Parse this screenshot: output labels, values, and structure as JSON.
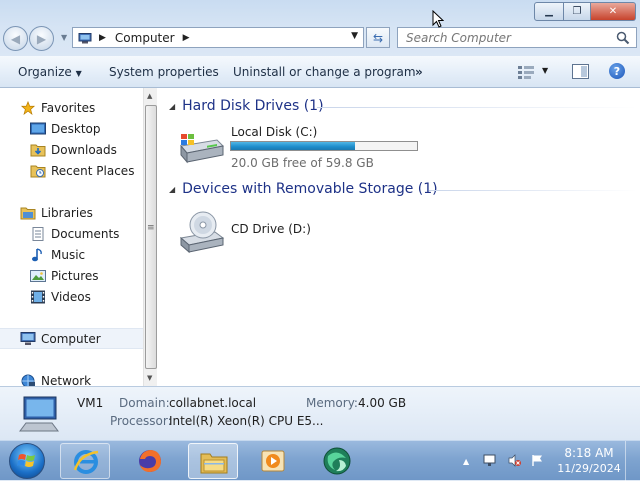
{
  "window": {
    "address": {
      "location": "Computer"
    },
    "search": {
      "placeholder": "Search Computer"
    }
  },
  "toolbar": {
    "organize_label": "Organize",
    "system_properties_label": "System properties",
    "uninstall_label": "Uninstall or change a program",
    "more_label": "»"
  },
  "navigation": {
    "favorites": {
      "label": "Favorites",
      "items": [
        {
          "label": "Desktop"
        },
        {
          "label": "Downloads"
        },
        {
          "label": "Recent Places"
        }
      ]
    },
    "libraries": {
      "label": "Libraries",
      "items": [
        {
          "label": "Documents"
        },
        {
          "label": "Music"
        },
        {
          "label": "Pictures"
        },
        {
          "label": "Videos"
        }
      ]
    },
    "computer": {
      "label": "Computer"
    },
    "network": {
      "label": "Network"
    }
  },
  "content": {
    "groups": [
      {
        "header": "Hard Disk Drives (1)",
        "items": [
          {
            "name": "Local Disk (C:)",
            "free_text": "20.0 GB free of 59.8 GB",
            "used_fraction": 0.666,
            "icon": "hard-drive-icon"
          }
        ]
      },
      {
        "header": "Devices with Removable Storage (1)",
        "items": [
          {
            "name": "CD Drive (D:)",
            "icon": "cd-drive-icon"
          }
        ]
      }
    ]
  },
  "details": {
    "computer_name": "VM1",
    "domain_label": "Domain:",
    "domain_value": "collabnet.local",
    "memory_label": "Memory:",
    "memory_value": "4.00 GB",
    "processor_label": "Processor:",
    "processor_value": "Intel(R) Xeon(R) CPU E5..."
  },
  "taskbar": {
    "pinned": [
      "internet-explorer-icon",
      "firefox-icon",
      "windows-explorer-icon",
      "media-player-icon",
      "app-icon"
    ],
    "clock": {
      "time": "8:18 AM",
      "date": "11/29/2024"
    }
  },
  "colors": {
    "group_header": "#1e3287",
    "drive_bar_fill": "#1d8ccb",
    "title_bar": "#d6e4f4",
    "taskbar": "#7fa4d0"
  }
}
